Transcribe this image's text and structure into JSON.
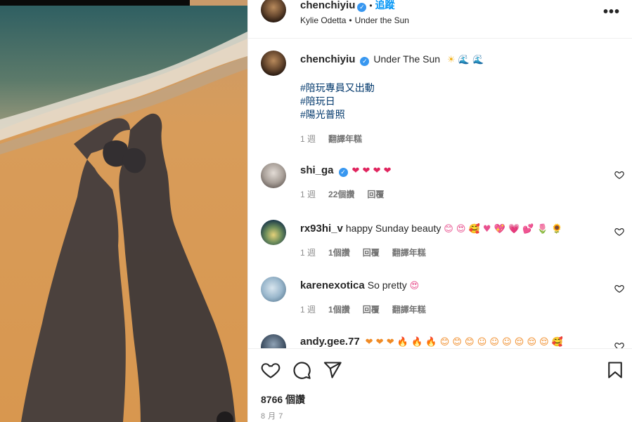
{
  "header": {
    "username": "chenchiyiu",
    "follow_label": "追蹤",
    "separator": "•",
    "sub_artist": "Kylie Odetta",
    "sub_sep": "•",
    "sub_song": "Under the Sun",
    "more_label": "•••"
  },
  "caption": {
    "username": "chenchiyiu",
    "text": "Under The Sun",
    "emojis": "☀ 🌊 🌊",
    "hashtags": [
      "#陪玩專員又出動",
      "#陪玩日",
      "#陽光普照"
    ],
    "time": "1 週",
    "translate": "翻譯年糕"
  },
  "comments": [
    {
      "username": "shi_ga",
      "verified": true,
      "text": "",
      "emojis": "❤ ❤ ❤ ❤",
      "time": "1 週",
      "likes": "22個讚",
      "reply": "回覆",
      "translate": ""
    },
    {
      "username": "rx93hi_v",
      "verified": false,
      "text": "happy Sunday beauty",
      "emojis": "😊 😍 🥰 ♥ 💖 💗 💕 🌷 🌻",
      "time": "1 週",
      "likes": "1個讚",
      "reply": "回覆",
      "translate": "翻譯年糕"
    },
    {
      "username": "karenexotica",
      "verified": false,
      "text": "So pretty",
      "emojis": "😍",
      "time": "1 週",
      "likes": "1個讚",
      "reply": "回覆",
      "translate": "翻譯年糕"
    },
    {
      "username": "andy.gee.77",
      "verified": false,
      "text": "",
      "emojis": "❤ ❤ ❤ 🔥 🔥 🔥 😊 😊 😊 ☺ ☺ ☺ 😌 😌 😌 🥰",
      "time": "",
      "likes": "",
      "reply": "",
      "translate": ""
    }
  ],
  "footer": {
    "likes": "8766 個讚",
    "date": "8 月 7"
  },
  "colors": {
    "link": "#0095f6",
    "hashtag": "#00376b",
    "meta": "#8e8e8e",
    "verified": "#3897f0"
  },
  "icons": [
    "heart-icon",
    "comment-icon",
    "share-icon",
    "bookmark-icon",
    "more-icon",
    "verified-icon"
  ]
}
